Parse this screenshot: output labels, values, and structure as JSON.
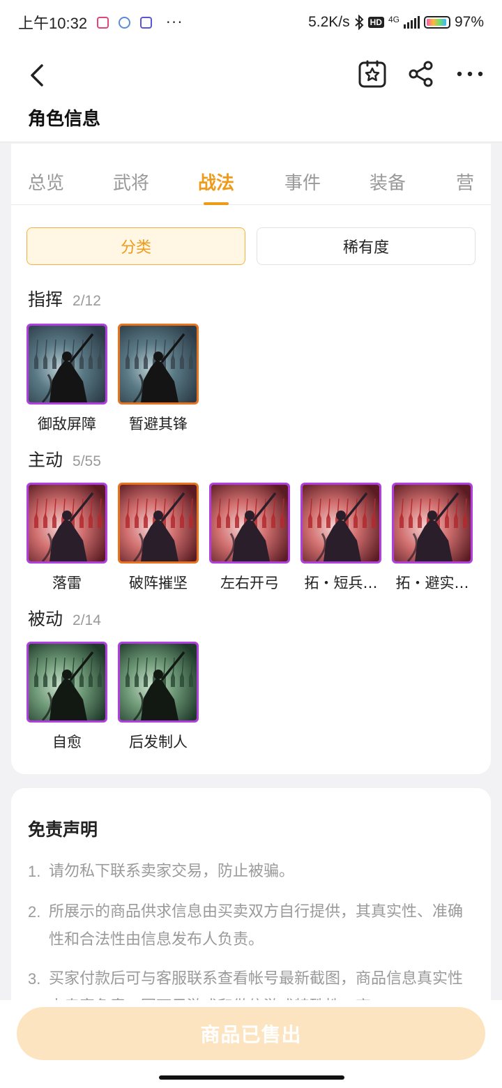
{
  "status_bar": {
    "time": "上午10:32",
    "dots": "···",
    "net_speed": "5.2K/s",
    "hd": "HD",
    "network": "4G",
    "battery": "97%"
  },
  "header": {
    "title": "角色信息",
    "icons": [
      "back-icon",
      "star-collect-icon",
      "share-icon",
      "more-icon"
    ]
  },
  "tabs": {
    "items": [
      "总览",
      "武将",
      "战法",
      "事件",
      "装备",
      "营"
    ],
    "active_index": 2
  },
  "filters": {
    "category": "分类",
    "rarity": "稀有度"
  },
  "sections": [
    {
      "name": "指挥",
      "count": "2/12",
      "skills": [
        {
          "label": "御敌屏障",
          "frame": "purple",
          "theme": "blue"
        },
        {
          "label": "暂避其锋",
          "frame": "orange",
          "theme": "blue"
        }
      ]
    },
    {
      "name": "主动",
      "count": "5/55",
      "skills": [
        {
          "label": "落雷",
          "frame": "purple",
          "theme": "red"
        },
        {
          "label": "破阵摧坚",
          "frame": "orange",
          "theme": "red"
        },
        {
          "label": "左右开弓",
          "frame": "purple",
          "theme": "red"
        },
        {
          "label": "拓・短兵…",
          "frame": "purple",
          "theme": "red"
        },
        {
          "label": "拓・避实…",
          "frame": "purple",
          "theme": "red"
        }
      ]
    },
    {
      "name": "被动",
      "count": "2/14",
      "skills": [
        {
          "label": "自愈",
          "frame": "purple",
          "theme": "green"
        },
        {
          "label": "后发制人",
          "frame": "purple",
          "theme": "green"
        }
      ]
    }
  ],
  "disclaimer": {
    "title": "免责声明",
    "items": [
      {
        "num": "1.",
        "text": "请勿私下联系卖家交易，防止被骗。"
      },
      {
        "num": "2.",
        "text": "所展示的商品供求信息由买卖双方自行提供，其真实性、准确性和合法性由信息发布人负责。"
      },
      {
        "num": "3.",
        "text": "买家付款后可与客服联系查看帐号最新截图，商品信息真实性由卖家负责，因可足游戏和做信游戏特殊性，商"
      }
    ]
  },
  "bottom": {
    "sold_label": "商品已售出"
  },
  "colors": {
    "accent": "#f09a1a",
    "purple_frame": "#b13fe0",
    "orange_frame": "#e8731e",
    "sold_button": "#fde4c0"
  }
}
